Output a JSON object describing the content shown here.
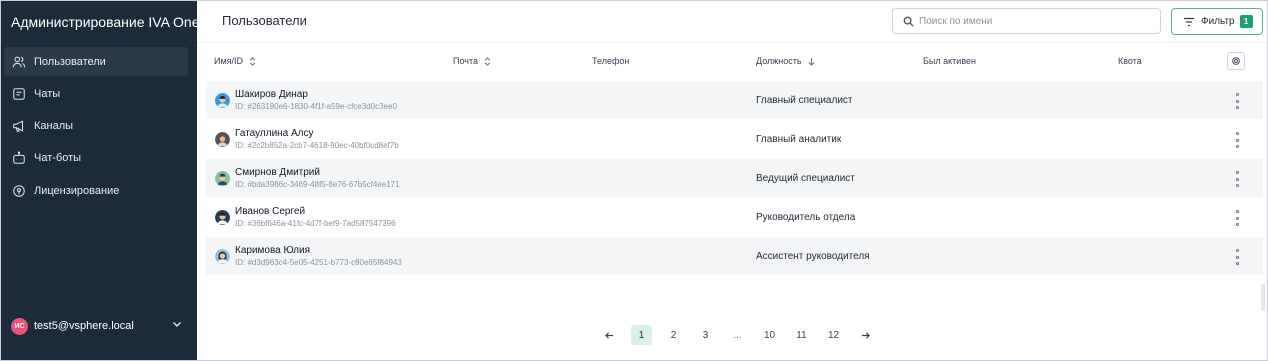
{
  "app": {
    "title": "Администрирование IVA One"
  },
  "sidebar": {
    "items": [
      {
        "label": "Пользователи",
        "icon": "users-icon",
        "active": true
      },
      {
        "label": "Чаты",
        "icon": "chat-icon",
        "active": false
      },
      {
        "label": "Каналы",
        "icon": "megaphone-icon",
        "active": false
      },
      {
        "label": "Чат-боты",
        "icon": "bot-icon",
        "active": false
      },
      {
        "label": "Лицензирование",
        "icon": "license-icon",
        "active": false
      }
    ],
    "user": {
      "initials": "ИС",
      "email": "test5@vsphere.local"
    }
  },
  "header": {
    "title": "Пользователи",
    "search_placeholder": "Поиск по имени",
    "filter_label": "Фильтр",
    "filter_count": "1"
  },
  "table": {
    "columns": {
      "name": "Имя/ID",
      "email": "Почта",
      "phone": "Телефон",
      "position": "Должность",
      "last_active": "Был активен",
      "quota": "Квота"
    },
    "rows": [
      {
        "name": "Шакиров Динар",
        "id": "ID: #263180e6-1830-4f1f-a59e-cfce3d0c3ee0",
        "position": "Главный специалист",
        "avatar_bg": "#3a9ad9",
        "avatar_skin": "#f2c9a0",
        "avatar_hair": "#2b2b2b"
      },
      {
        "name": "Гатауллина Алсу",
        "id": "ID: #2c2b852a-2cb7-4618-90ec-40bf0cd8ef7b",
        "position": "Главный аналитик",
        "avatar_bg": "#4b5563",
        "avatar_skin": "#e9b99a",
        "avatar_hair": "#7a4a2a"
      },
      {
        "name": "Смирнов Дмитрий",
        "id": "ID: #bda3986c-3469-48f5-8e76-67b5cf4ee171",
        "position": "Ведущий специалист",
        "avatar_bg": "#7cc49a",
        "avatar_skin": "#f1c7a2",
        "avatar_hair": "#3b3b3b"
      },
      {
        "name": "Иванов Сергей",
        "id": "ID: #36bf646a-41fc-4d7f-bef9-7ad587547396",
        "position": "Руководитель отдела",
        "avatar_bg": "#233a5b",
        "avatar_skin": "#efc4a0",
        "avatar_hair": "#1f1f1f"
      },
      {
        "name": "Каримова Юлия",
        "id": "ID: #d3d963c4-5e05-4251-b773-c80e85f84943",
        "position": "Ассистент руководителя",
        "avatar_bg": "#8fc2e8",
        "avatar_skin": "#f0c9a6",
        "avatar_hair": "#2d2d2d"
      }
    ]
  },
  "pagination": {
    "pages": [
      "1",
      "2",
      "3",
      "...",
      "10",
      "11",
      "12"
    ],
    "current": "1"
  },
  "colors": {
    "sidebar_bg": "#1c2b3a",
    "accent": "#1f9e73",
    "active_page_bg": "#d8f1e6"
  }
}
